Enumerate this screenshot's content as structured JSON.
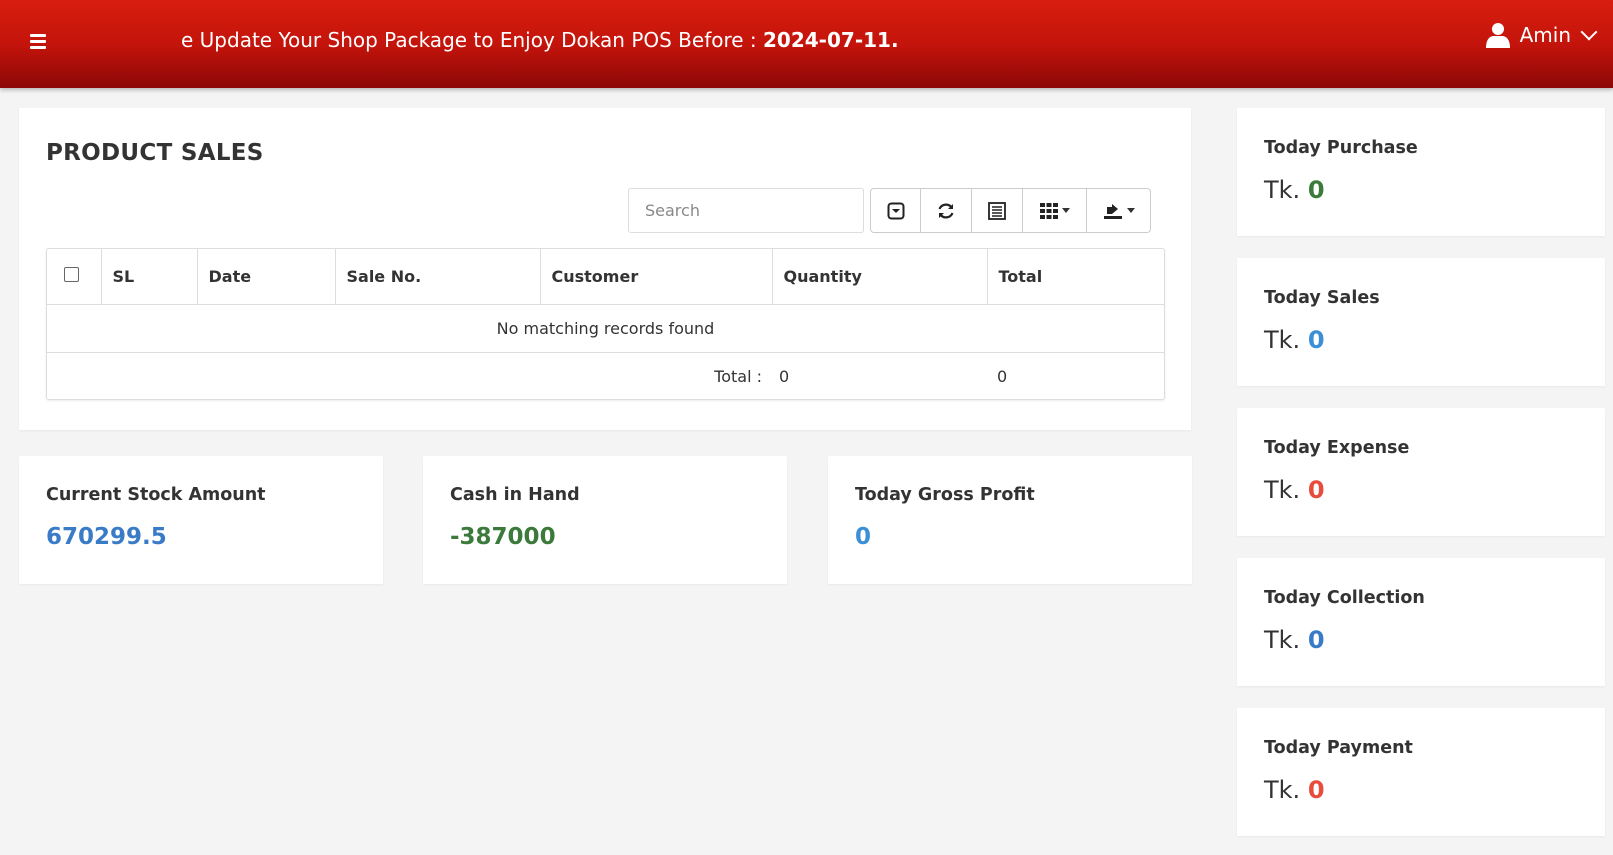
{
  "header": {
    "marquee_text": "e Update Your Shop Package to Enjoy Dokan POS Before : ",
    "marquee_date": "2024-07-11.",
    "user_name": "Amin"
  },
  "sales": {
    "title": "PRODUCT SALES",
    "search_placeholder": "Search",
    "columns": [
      "SL",
      "Date",
      "Sale No.",
      "Customer",
      "Quantity",
      "Total"
    ],
    "empty_message": "No matching records found",
    "footer_label": "Total :",
    "footer_quantity": "0",
    "footer_total": "0"
  },
  "summary": [
    {
      "title": "Current Stock Amount",
      "value": "670299.5",
      "color": "#3a7bc8"
    },
    {
      "title": "Cash in Hand",
      "value": "-387000",
      "color": "#3c7a3c"
    },
    {
      "title": "Today Gross Profit",
      "value": "0",
      "color": "#3a8fd6"
    }
  ],
  "today": [
    {
      "title": "Today Purchase",
      "prefix": "Tk.",
      "value": "0",
      "color": "#3c7a3c"
    },
    {
      "title": "Today Sales",
      "prefix": "Tk.",
      "value": "0",
      "color": "#3a8fd6"
    },
    {
      "title": "Today Expense",
      "prefix": "Tk.",
      "value": "0",
      "color": "#e74c3c"
    },
    {
      "title": "Today Collection",
      "prefix": "Tk.",
      "value": "0",
      "color": "#3a7bc8"
    },
    {
      "title": "Today Payment",
      "prefix": "Tk.",
      "value": "0",
      "color": "#e74c3c"
    }
  ],
  "icons": {
    "menu": "hamburger-icon",
    "user": "user-icon",
    "toggle": "toggle-view-icon",
    "refresh": "refresh-icon",
    "list": "list-icon",
    "columns": "columns-grid-icon",
    "export": "export-icon"
  }
}
